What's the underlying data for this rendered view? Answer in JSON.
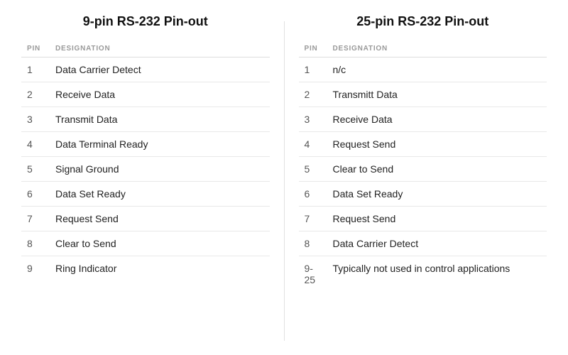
{
  "left_table": {
    "title": "9-pin RS-232 Pin-out",
    "col_pin": "PIN",
    "col_designation": "DESIGNATION",
    "rows": [
      {
        "pin": "1",
        "designation": "Data Carrier Detect"
      },
      {
        "pin": "2",
        "designation": "Receive Data"
      },
      {
        "pin": "3",
        "designation": "Transmit Data"
      },
      {
        "pin": "4",
        "designation": "Data Terminal Ready"
      },
      {
        "pin": "5",
        "designation": "Signal Ground"
      },
      {
        "pin": "6",
        "designation": "Data Set Ready"
      },
      {
        "pin": "7",
        "designation": "Request Send"
      },
      {
        "pin": "8",
        "designation": "Clear to Send"
      },
      {
        "pin": "9",
        "designation": "Ring Indicator"
      }
    ]
  },
  "right_table": {
    "title": "25-pin RS-232 Pin-out",
    "col_pin": "PIN",
    "col_designation": "DESIGNATION",
    "rows": [
      {
        "pin": "1",
        "designation": "n/c"
      },
      {
        "pin": "2",
        "designation": "Transmitt Data"
      },
      {
        "pin": "3",
        "designation": "Receive Data"
      },
      {
        "pin": "4",
        "designation": "Request Send"
      },
      {
        "pin": "5",
        "designation": "Clear to Send"
      },
      {
        "pin": "6",
        "designation": "Data Set Ready"
      },
      {
        "pin": "7",
        "designation": "Request Send"
      },
      {
        "pin": "8",
        "designation": "Data Carrier Detect"
      },
      {
        "pin": "9-25",
        "designation": "Typically not used in control applications"
      }
    ]
  }
}
